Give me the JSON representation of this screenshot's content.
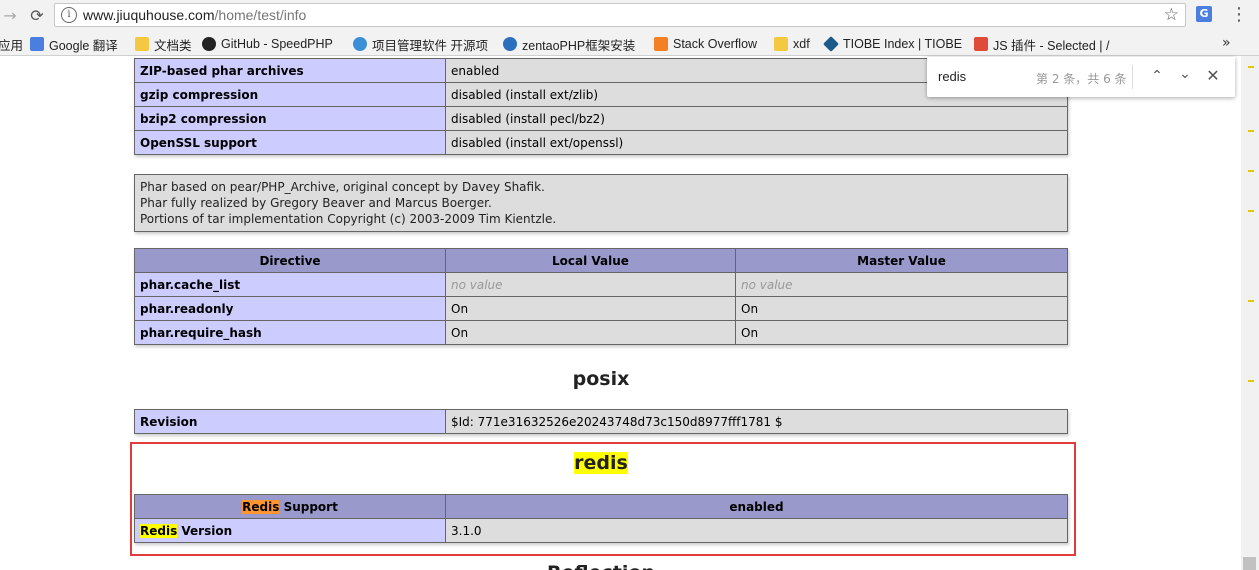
{
  "browser": {
    "url_host": "www.jiuquhouse.com",
    "url_path": "/home/test/info",
    "bookmarks": [
      {
        "label": "应用",
        "icon": "apps-icon",
        "color": "#4a7fe0"
      },
      {
        "label": "Google 翻译",
        "icon": "google-translate-icon",
        "color": "#4a7fe0"
      },
      {
        "label": "文档类",
        "icon": "folder-icon",
        "color": "#f5c842"
      },
      {
        "label": "GitHub - SpeedPHP",
        "icon": "github-icon",
        "color": "#222222"
      },
      {
        "label": "项目管理软件 开源项",
        "icon": "zentao-icon",
        "color": "#3a8fd6"
      },
      {
        "label": "zentaoPHP框架安装",
        "icon": "edge-icon",
        "color": "#2c6fbf"
      },
      {
        "label": "Stack Overflow",
        "icon": "stackoverflow-icon",
        "color": "#f48024"
      },
      {
        "label": "xdf",
        "icon": "folder-icon",
        "color": "#f5c842"
      },
      {
        "label": "TIOBE Index | TIOBE",
        "icon": "tiobe-icon",
        "color": "#1d5a8c"
      },
      {
        "label": "JS 插件 - Selected | /",
        "icon": "windows-icon",
        "color": "#e04a3a"
      }
    ],
    "more": "»"
  },
  "find": {
    "query": "redis",
    "count": "第 2 条，共 6 条"
  },
  "phar_table": [
    {
      "name": "ZIP-based phar archives",
      "value": "enabled"
    },
    {
      "name": "gzip compression",
      "value": "disabled (install ext/zlib)"
    },
    {
      "name": "bzip2 compression",
      "value": "disabled (install pecl/bz2)"
    },
    {
      "name": "OpenSSL support",
      "value": "disabled (install ext/openssl)"
    }
  ],
  "credits": [
    "Phar based on pear/PHP_Archive, original concept by Davey Shafik.",
    "Phar fully realized by Gregory Beaver and Marcus Boerger.",
    "Portions of tar implementation Copyright (c) 2003-2009 Tim Kientzle."
  ],
  "directive_table": {
    "headers": [
      "Directive",
      "Local Value",
      "Master Value"
    ],
    "rows": [
      {
        "name": "phar.cache_list",
        "local": "no value",
        "master": "no value"
      },
      {
        "name": "phar.readonly",
        "local": "On",
        "master": "On"
      },
      {
        "name": "phar.require_hash",
        "local": "On",
        "master": "On"
      }
    ]
  },
  "posix": {
    "title": "posix",
    "revision_label": "Revision",
    "revision_value": "$Id: 771e31632526e20243748d73c150d8977fff1781 $"
  },
  "redis": {
    "title": "redis",
    "support_hl": "Redis",
    "support_rest": " Support",
    "support_value": "enabled",
    "version_hl": "Redis",
    "version_rest": " Version",
    "version_value": "3.1.0"
  },
  "next_section": "Reflection"
}
